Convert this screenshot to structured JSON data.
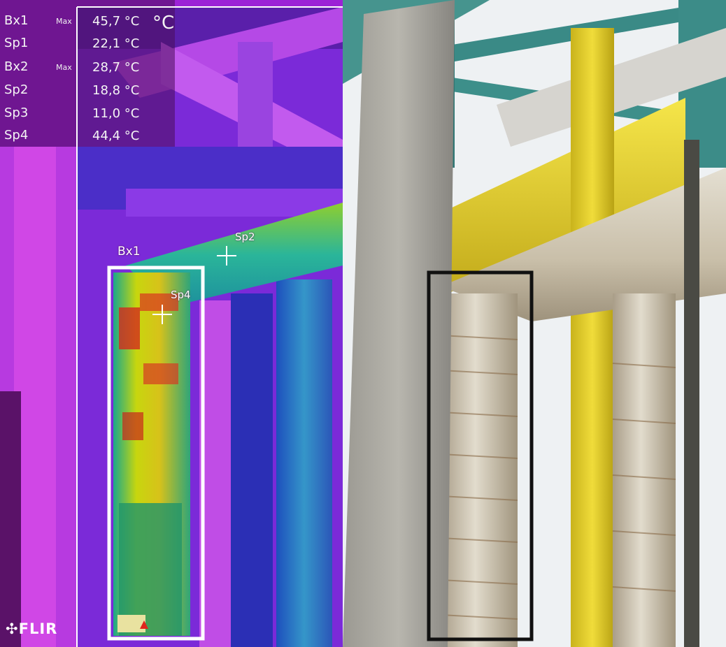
{
  "thermal": {
    "unit": "°C",
    "measurements": [
      {
        "label": "Bx1",
        "qualifier": "Max",
        "value": "45,7 °C"
      },
      {
        "label": "Sp1",
        "qualifier": "",
        "value": "22,1 °C"
      },
      {
        "label": "Bx2",
        "qualifier": "Max",
        "value": "28,7 °C"
      },
      {
        "label": "Sp2",
        "qualifier": "",
        "value": "18,8 °C"
      },
      {
        "label": "Sp3",
        "qualifier": "",
        "value": "11,0 °C"
      },
      {
        "label": "Sp4",
        "qualifier": "",
        "value": "44,4 °C"
      }
    ],
    "box_label": "Bx1",
    "spot_labels": {
      "sp2": "Sp2",
      "sp4": "Sp4"
    },
    "brand": "FLIR"
  }
}
